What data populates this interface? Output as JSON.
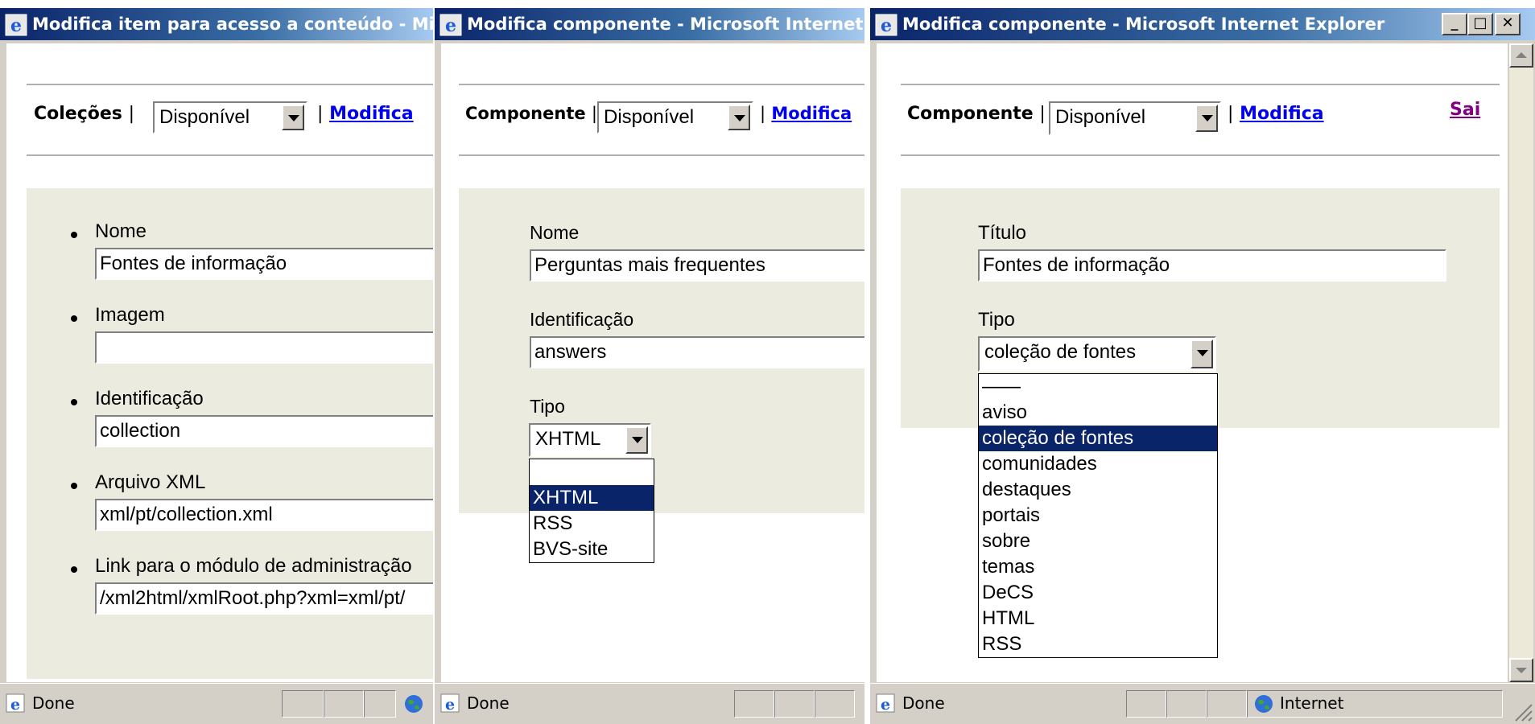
{
  "windows": [
    {
      "title": "Modifica item para acesso a conteúdo - Microsoft Internet Explorer",
      "status": "Done",
      "toolbar": {
        "section": "Coleções",
        "select_value": "Disponível",
        "link": "Modifica"
      },
      "fields": [
        {
          "label": "Nome",
          "value": "Fontes de informação"
        },
        {
          "label": "Imagem",
          "value": ""
        },
        {
          "label": "Identificação",
          "value": "collection"
        },
        {
          "label": "Arquivo XML",
          "value": "xml/pt/collection.xml"
        },
        {
          "label": "Link para o módulo de administração",
          "value": "/xml2html/xmlRoot.php?xml=xml/pt/"
        }
      ]
    },
    {
      "title": "Modifica componente - Microsoft Internet Explorer",
      "status": "Done",
      "toolbar": {
        "section": "Componente",
        "select_value": "Disponível",
        "link": "Modifica"
      },
      "fields": [
        {
          "label": "Nome",
          "value": "Perguntas mais frequentes"
        },
        {
          "label": "Identificação",
          "value": "answers"
        }
      ],
      "tipo": {
        "label": "Tipo",
        "value": "XHTML",
        "options": [
          "",
          "XHTML",
          "RSS",
          "BVS-site"
        ],
        "selected": "XHTML"
      }
    },
    {
      "title": "Modifica componente - Microsoft Internet Explorer",
      "status": "Done",
      "zone": "Internet",
      "exit_link": "Sai",
      "toolbar": {
        "section": "Componente",
        "select_value": "Disponível",
        "link": "Modifica"
      },
      "fields": [
        {
          "label": "Título",
          "value": "Fontes de informação"
        }
      ],
      "tipo": {
        "label": "Tipo",
        "value": "coleção de fontes",
        "options": [
          "——",
          "aviso",
          "coleção de fontes",
          "comunidades",
          "destaques",
          "portais",
          "sobre",
          "temas",
          "DeCS",
          "HTML",
          "RSS"
        ],
        "selected": "coleção de fontes"
      }
    }
  ],
  "colors": {
    "title_bar": "#0a246a",
    "panel": "#ecebe0",
    "link": "#0000ee",
    "visited_link": "#800080",
    "selection": "#0a246a"
  }
}
